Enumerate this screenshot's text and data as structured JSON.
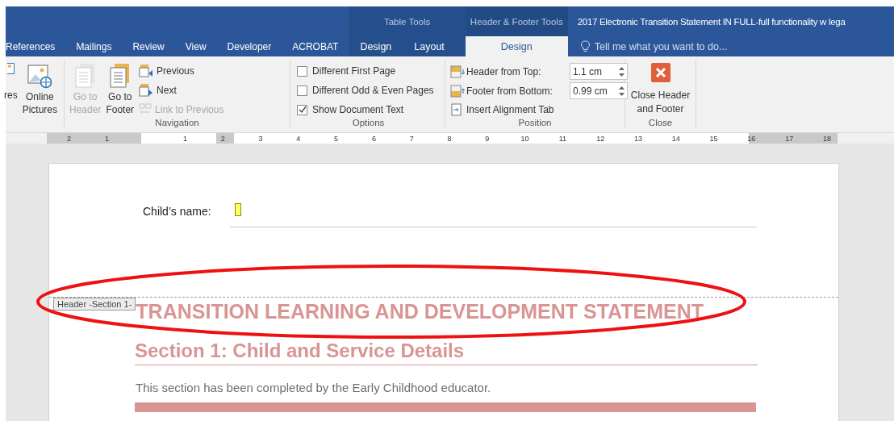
{
  "window": {
    "title": "2017 Electronic Transition Statement IN FULL-full functionality w lega"
  },
  "tabs": [
    {
      "label": "References",
      "selected": false,
      "kind": "normal"
    },
    {
      "label": "Mailings",
      "selected": false,
      "kind": "normal"
    },
    {
      "label": "Review",
      "selected": false,
      "kind": "normal"
    },
    {
      "label": "View",
      "selected": false,
      "kind": "normal"
    },
    {
      "label": "Developer",
      "selected": false,
      "kind": "normal"
    },
    {
      "label": "ACROBAT",
      "selected": false,
      "kind": "normal"
    }
  ],
  "context_groups": [
    {
      "label": "Table Tools",
      "kind": "table",
      "tabs": [
        {
          "label": "Design",
          "selected": false
        },
        {
          "label": "Layout",
          "selected": false
        }
      ]
    },
    {
      "label": "Header & Footer Tools",
      "kind": "header",
      "tabs": [
        {
          "label": "Design",
          "selected": true
        }
      ]
    }
  ],
  "tell_me": {
    "placeholder": "Tell me what you want to do..."
  },
  "ribbon": {
    "insert_group": {
      "cut_label": "res",
      "online_pictures": "Online\nPictures"
    },
    "navigation": {
      "label": "Navigation",
      "go_to_header": {
        "label": "Go to\nHeader",
        "disabled": true
      },
      "go_to_footer": {
        "label": "Go to\nFooter",
        "disabled": false
      },
      "small": [
        {
          "label": "Previous",
          "disabled": false,
          "kind": "previous"
        },
        {
          "label": "Next",
          "disabled": false,
          "kind": "next"
        },
        {
          "label": "Link to Previous",
          "disabled": true,
          "kind": "link"
        }
      ]
    },
    "options": {
      "label": "Options",
      "items": [
        {
          "label": "Different First Page",
          "checked": false
        },
        {
          "label": "Different Odd & Even Pages",
          "checked": false
        },
        {
          "label": "Show Document Text",
          "checked": true
        }
      ]
    },
    "position": {
      "label": "Position",
      "fields": [
        {
          "label": "Header from Top:",
          "value": "1.1 cm",
          "kind": "header"
        },
        {
          "label": "Footer from Bottom:",
          "value": "0.99 cm",
          "kind": "footer"
        }
      ],
      "insert_tab": "Insert Alignment Tab"
    },
    "close": {
      "label": "Close",
      "button": "Close Header\nand Footer"
    }
  },
  "ruler": {
    "left_numbers": [
      "2",
      "1"
    ],
    "numbers": [
      "1",
      "2",
      "3",
      "4",
      "5",
      "6",
      "7",
      "8",
      "9",
      "10",
      "11",
      "12",
      "13",
      "14",
      "15",
      "16",
      "17",
      "18"
    ]
  },
  "document": {
    "field_label": "Child’s name:",
    "header_tag": "Header -Section 1-",
    "title": "TRANSITION LEARNING AND DEVELOPMENT STATEMENT",
    "section_heading": "Section 1: Child and Service Details",
    "paragraph": "This section has been completed by the Early Childhood educator."
  }
}
